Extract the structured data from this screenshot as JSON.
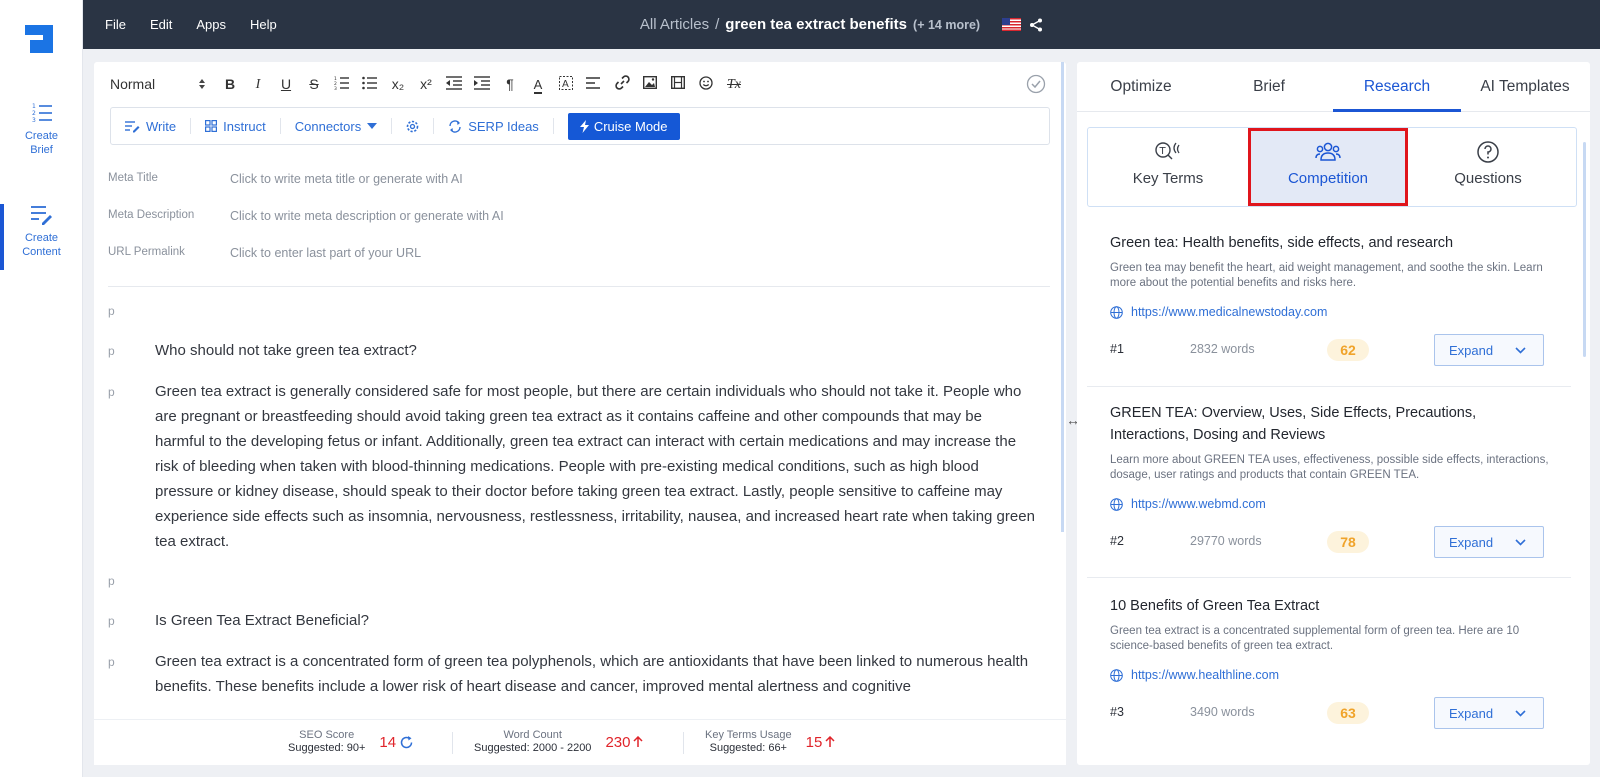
{
  "app": {
    "menu": [
      "File",
      "Edit",
      "Apps",
      "Help"
    ],
    "breadcrumb": {
      "root": "All Articles",
      "separator": "/",
      "title": "green tea extract benefits",
      "more": "(+ 14 more)"
    },
    "accent": "#1b56d4"
  },
  "rail": {
    "items": [
      {
        "label_1": "Create",
        "label_2": "Brief"
      },
      {
        "label_1": "Create",
        "label_2": "Content"
      }
    ]
  },
  "toolbar": {
    "format": "Normal",
    "buttons": [
      "B",
      "I",
      "U",
      "S",
      "ordered-list",
      "bullet-list",
      "x₂",
      "x²",
      "outdent",
      "indent",
      "¶",
      "A",
      "highlight",
      "align",
      "link",
      "image",
      "video",
      "emoji",
      "Tx"
    ]
  },
  "actions": {
    "write": "Write",
    "instruct": "Instruct",
    "connectors": "Connectors",
    "serp": "SERP Ideas",
    "cruise": "Cruise Mode"
  },
  "meta": {
    "title_label": "Meta Title",
    "title_placeholder": "Click to write meta title or generate with AI",
    "desc_label": "Meta Description",
    "desc_placeholder": "Click to write meta description or generate with AI",
    "url_label": "URL Permalink",
    "url_placeholder": "Click to enter last part of your URL"
  },
  "content": {
    "tag": "p",
    "paragraphs": [
      "",
      "Who should not take green tea extract?",
      "Green tea extract is generally considered safe for most people, but there are certain individuals who should not take it. People who are pregnant or breastfeeding should avoid taking green tea extract as it contains caffeine and other compounds that may be harmful to the developing fetus or infant. Additionally, green tea extract can interact with certain medications and may increase the risk of bleeding when taken with blood-thinning medications. People with pre-existing medical conditions, such as high blood pressure or kidney disease, should speak to their doctor before taking green tea extract. Lastly, people sensitive to caffeine may experience side effects such as insomnia, nervousness, restlessness, irritability, nausea, and increased heart rate when taking green tea extract.",
      "",
      "Is Green Tea Extract Beneficial?",
      "Green tea extract is a concentrated form of green tea polyphenols, which are antioxidants that have been linked to numerous health benefits. These benefits include a lower risk of heart disease and cancer, improved mental alertness and cognitive"
    ]
  },
  "footer": {
    "seo": {
      "label": "SEO Score",
      "suggested": "Suggested: 90+",
      "value": "14"
    },
    "words": {
      "label": "Word Count",
      "suggested": "Suggested: 2000 - 2200",
      "value": "230"
    },
    "terms": {
      "label": "Key Terms Usage",
      "suggested": "Suggested: 66+",
      "value": "15"
    }
  },
  "panel": {
    "tabs": [
      "Optimize",
      "Brief",
      "Research",
      "AI Templates"
    ],
    "active_tab": "Research",
    "subtabs": [
      "Key Terms",
      "Competition",
      "Questions"
    ],
    "active_subtab": "Competition",
    "expand_label": "Expand",
    "results": [
      {
        "title": "Green tea: Health benefits, side effects, and research",
        "desc": "Green tea may benefit the heart, aid weight management, and soothe the skin. Learn more about the potential benefits and risks here.",
        "url": "https://www.medicalnewstoday.com",
        "rank": "#1",
        "words": "2832 words",
        "score": "62"
      },
      {
        "title": "GREEN TEA: Overview, Uses, Side Effects, Precautions, Interactions, Dosing and Reviews",
        "desc": "Learn more about GREEN TEA uses, effectiveness, possible side effects, interactions, dosage, user ratings and products that contain GREEN TEA.",
        "url": "https://www.webmd.com",
        "rank": "#2",
        "words": "29770 words",
        "score": "78"
      },
      {
        "title": "10 Benefits of Green Tea Extract",
        "desc": "Green tea extract is a concentrated supplemental form of green tea. Here are 10 science-based benefits of green tea extract.",
        "url": "https://www.healthline.com",
        "rank": "#3",
        "words": "3490 words",
        "score": "63"
      }
    ]
  }
}
